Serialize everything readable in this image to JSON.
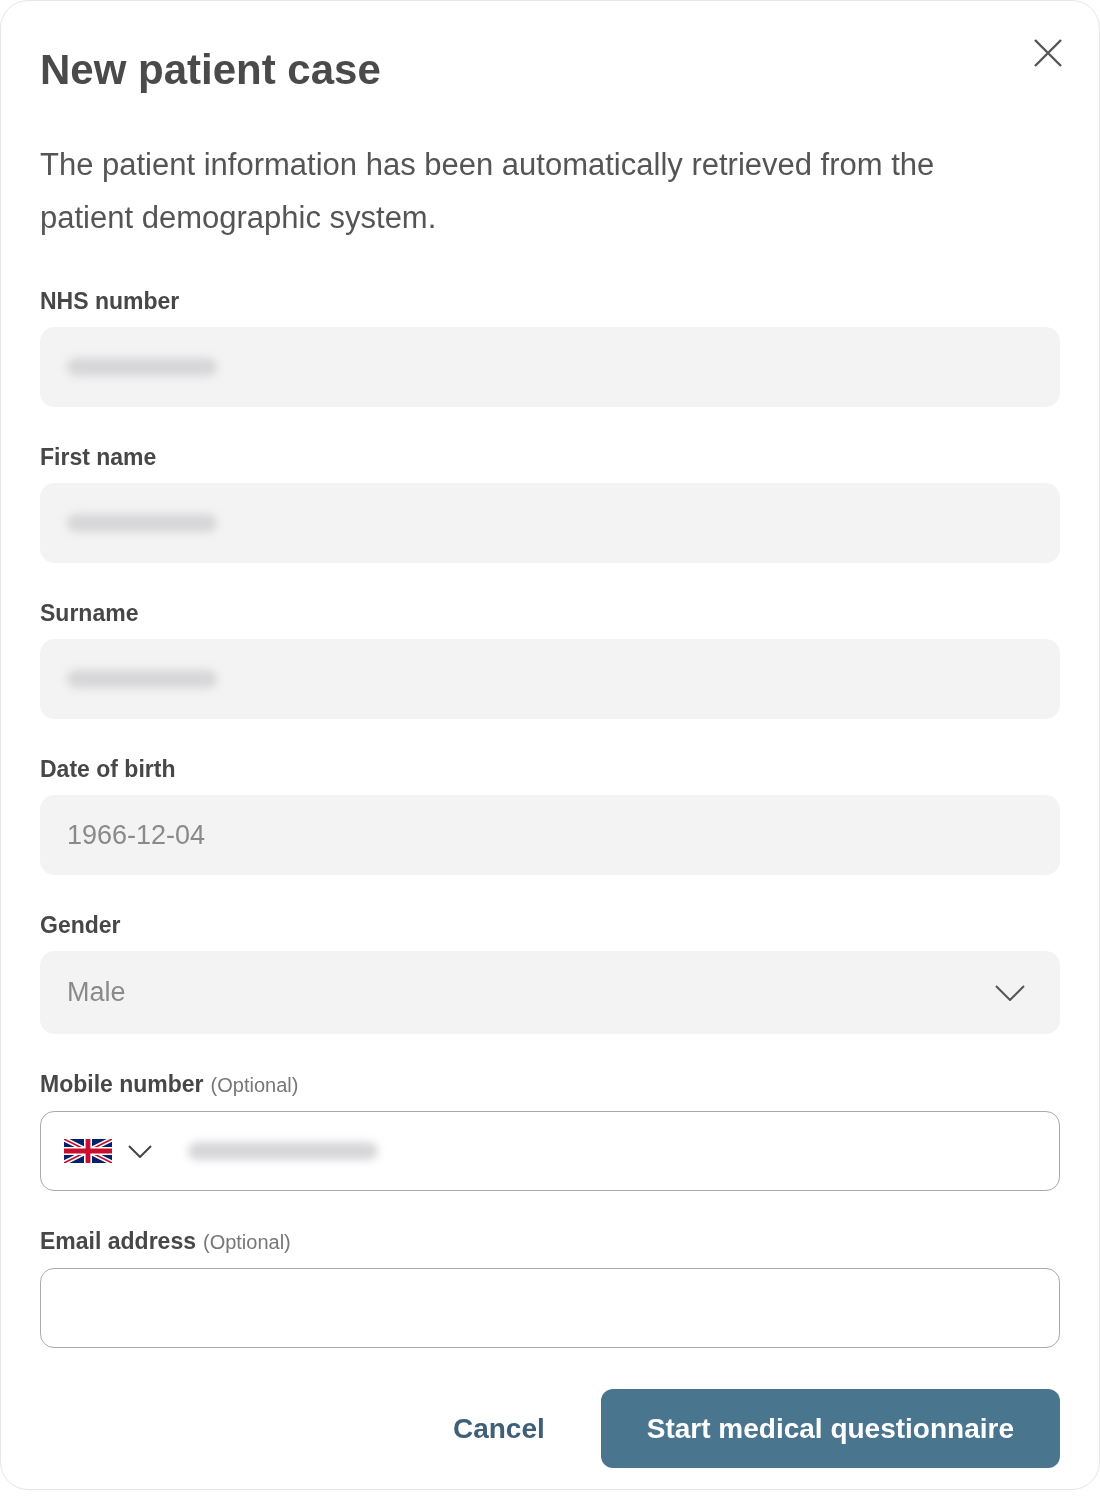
{
  "dialog": {
    "title": "New patient case",
    "description": "The patient information has been automatically retrieved from the patient demographic system."
  },
  "fields": [
    {
      "kind": "text",
      "label": "NHS number",
      "disabled": true,
      "redacted": true
    },
    {
      "kind": "text",
      "label": "First name",
      "disabled": true,
      "redacted": true
    },
    {
      "kind": "text",
      "label": "Surname",
      "disabled": true,
      "redacted": true
    },
    {
      "kind": "text",
      "label": "Date of birth",
      "disabled": true,
      "redacted": false,
      "value": "1966-12-04"
    },
    {
      "kind": "select",
      "label": "Gender",
      "disabled": true,
      "redacted": false,
      "value": "Male"
    },
    {
      "kind": "phone",
      "label": "Mobile number",
      "hint": "(Optional)",
      "disabled": false,
      "redacted": true
    },
    {
      "kind": "text",
      "label": "Email address",
      "hint": "(Optional)",
      "disabled": false,
      "redacted": false
    }
  ],
  "buttons": [
    {
      "kind": "link",
      "label": "Cancel"
    },
    {
      "kind": "primary",
      "label": "Start medical questionnaire"
    }
  ]
}
